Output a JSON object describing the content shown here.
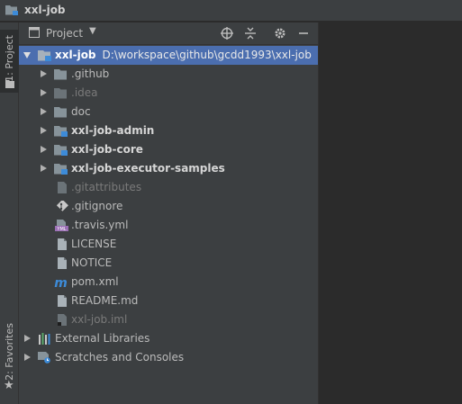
{
  "window": {
    "title": "xxl-job"
  },
  "side_tabs": {
    "project": "1: Project",
    "favorites": "2: Favorites"
  },
  "panel": {
    "view_label": "Project"
  },
  "tree": {
    "root": {
      "name": "xxl-job",
      "path": "D:\\workspace\\github\\gcdd1993\\xxl-job"
    },
    "items": [
      {
        "label": ".github",
        "kind": "folder"
      },
      {
        "label": ".idea",
        "kind": "folder-dim"
      },
      {
        "label": "doc",
        "kind": "folder"
      },
      {
        "label": "xxl-job-admin",
        "kind": "module"
      },
      {
        "label": "xxl-job-core",
        "kind": "module"
      },
      {
        "label": "xxl-job-executor-samples",
        "kind": "module"
      },
      {
        "label": ".gitattributes",
        "kind": "file-dim"
      },
      {
        "label": ".gitignore",
        "kind": "gitignore"
      },
      {
        "label": ".travis.yml",
        "kind": "yml"
      },
      {
        "label": "LICENSE",
        "kind": "text"
      },
      {
        "label": "NOTICE",
        "kind": "text"
      },
      {
        "label": "pom.xml",
        "kind": "maven"
      },
      {
        "label": "README.md",
        "kind": "markdown"
      },
      {
        "label": "xxl-job.iml",
        "kind": "iml"
      }
    ],
    "external_libraries": "External Libraries",
    "scratches": "Scratches and Consoles"
  },
  "colors": {
    "selection": "#4b6eaf",
    "folder": "#87939a",
    "module_badge": "#3d8bd8"
  }
}
